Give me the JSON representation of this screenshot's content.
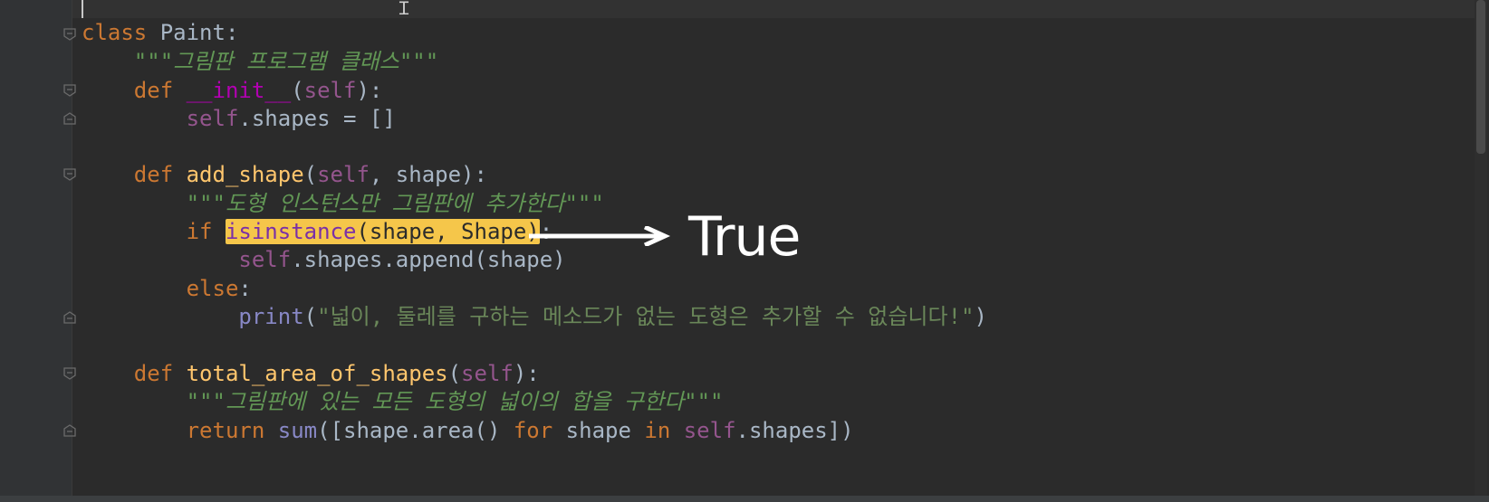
{
  "editor": {
    "lines": [
      {
        "parts": [
          {
            "t": "class",
            "c": "kw"
          },
          {
            "t": " Paint:",
            "c": "plain"
          }
        ]
      },
      {
        "parts": [
          {
            "t": "    ",
            "c": "plain"
          },
          {
            "t": "\"\"\"그림판 프로그램 클래스\"\"\"",
            "c": "doc"
          }
        ]
      },
      {
        "parts": [
          {
            "t": "    ",
            "c": "plain"
          },
          {
            "t": "def",
            "c": "kw"
          },
          {
            "t": " ",
            "c": "plain"
          },
          {
            "t": "__init__",
            "c": "magic"
          },
          {
            "t": "(",
            "c": "plain"
          },
          {
            "t": "self",
            "c": "self"
          },
          {
            "t": "):",
            "c": "plain"
          }
        ]
      },
      {
        "parts": [
          {
            "t": "        ",
            "c": "plain"
          },
          {
            "t": "self",
            "c": "self"
          },
          {
            "t": ".shapes = []",
            "c": "plain"
          }
        ]
      },
      {
        "parts": []
      },
      {
        "parts": [
          {
            "t": "    ",
            "c": "plain"
          },
          {
            "t": "def",
            "c": "kw"
          },
          {
            "t": " ",
            "c": "plain"
          },
          {
            "t": "add_shape",
            "c": "fn"
          },
          {
            "t": "(",
            "c": "plain"
          },
          {
            "t": "self",
            "c": "self"
          },
          {
            "t": ", shape):",
            "c": "plain"
          }
        ]
      },
      {
        "parts": [
          {
            "t": "        ",
            "c": "plain"
          },
          {
            "t": "\"\"\"도형 인스턴스만 그림판에 추가한다\"\"\"",
            "c": "doc"
          }
        ]
      },
      {
        "parts": [
          {
            "t": "        ",
            "c": "plain"
          },
          {
            "t": "if",
            "c": "kw"
          },
          {
            "t": " ",
            "c": "plain"
          },
          {
            "t": "isinstance",
            "c": "hl-fn"
          },
          {
            "t": "(shape, Shape)",
            "c": "hl-txt"
          },
          {
            "t": ":",
            "c": "plain"
          }
        ]
      },
      {
        "parts": [
          {
            "t": "            ",
            "c": "plain"
          },
          {
            "t": "self",
            "c": "self"
          },
          {
            "t": ".shapes.append(shape)",
            "c": "plain"
          }
        ]
      },
      {
        "parts": [
          {
            "t": "        ",
            "c": "plain"
          },
          {
            "t": "else",
            "c": "kw"
          },
          {
            "t": ":",
            "c": "plain"
          }
        ]
      },
      {
        "parts": [
          {
            "t": "            ",
            "c": "plain"
          },
          {
            "t": "print",
            "c": "builtin"
          },
          {
            "t": "(",
            "c": "plain"
          },
          {
            "t": "\"넓이, 둘레를 구하는 메소드가 없는 도형은 추가할 수 없습니다!\"",
            "c": "str"
          },
          {
            "t": ")",
            "c": "plain"
          }
        ]
      },
      {
        "parts": []
      },
      {
        "parts": [
          {
            "t": "    ",
            "c": "plain"
          },
          {
            "t": "def",
            "c": "kw"
          },
          {
            "t": " ",
            "c": "plain"
          },
          {
            "t": "total_area_of_shapes",
            "c": "fn"
          },
          {
            "t": "(",
            "c": "plain"
          },
          {
            "t": "self",
            "c": "self"
          },
          {
            "t": "):",
            "c": "plain"
          }
        ]
      },
      {
        "parts": [
          {
            "t": "        ",
            "c": "plain"
          },
          {
            "t": "\"\"\"그림판에 있는 모든 도형의 넓이의 합을 구한다\"\"\"",
            "c": "doc"
          }
        ]
      },
      {
        "parts": [
          {
            "t": "        ",
            "c": "plain"
          },
          {
            "t": "return",
            "c": "kw"
          },
          {
            "t": " ",
            "c": "plain"
          },
          {
            "t": "sum",
            "c": "builtin"
          },
          {
            "t": "([shape.area() ",
            "c": "plain"
          },
          {
            "t": "for",
            "c": "kw"
          },
          {
            "t": " shape ",
            "c": "plain"
          },
          {
            "t": "in",
            "c": "kw"
          },
          {
            "t": " ",
            "c": "plain"
          },
          {
            "t": "self",
            "c": "self"
          },
          {
            "t": ".shapes])",
            "c": "plain"
          }
        ]
      }
    ]
  },
  "annotation": {
    "label": "True",
    "arrow_icon": "right-arrow-icon"
  },
  "gutter": {
    "fold_icon": "fold-marker-icon"
  },
  "colors": {
    "background": "#2b2b2b",
    "keyword": "#cc7832",
    "self": "#94558d",
    "function": "#ffc66d",
    "docstring": "#629755",
    "string": "#6a8759",
    "highlight": "#f5c64a",
    "annotation": "#ffffff"
  }
}
